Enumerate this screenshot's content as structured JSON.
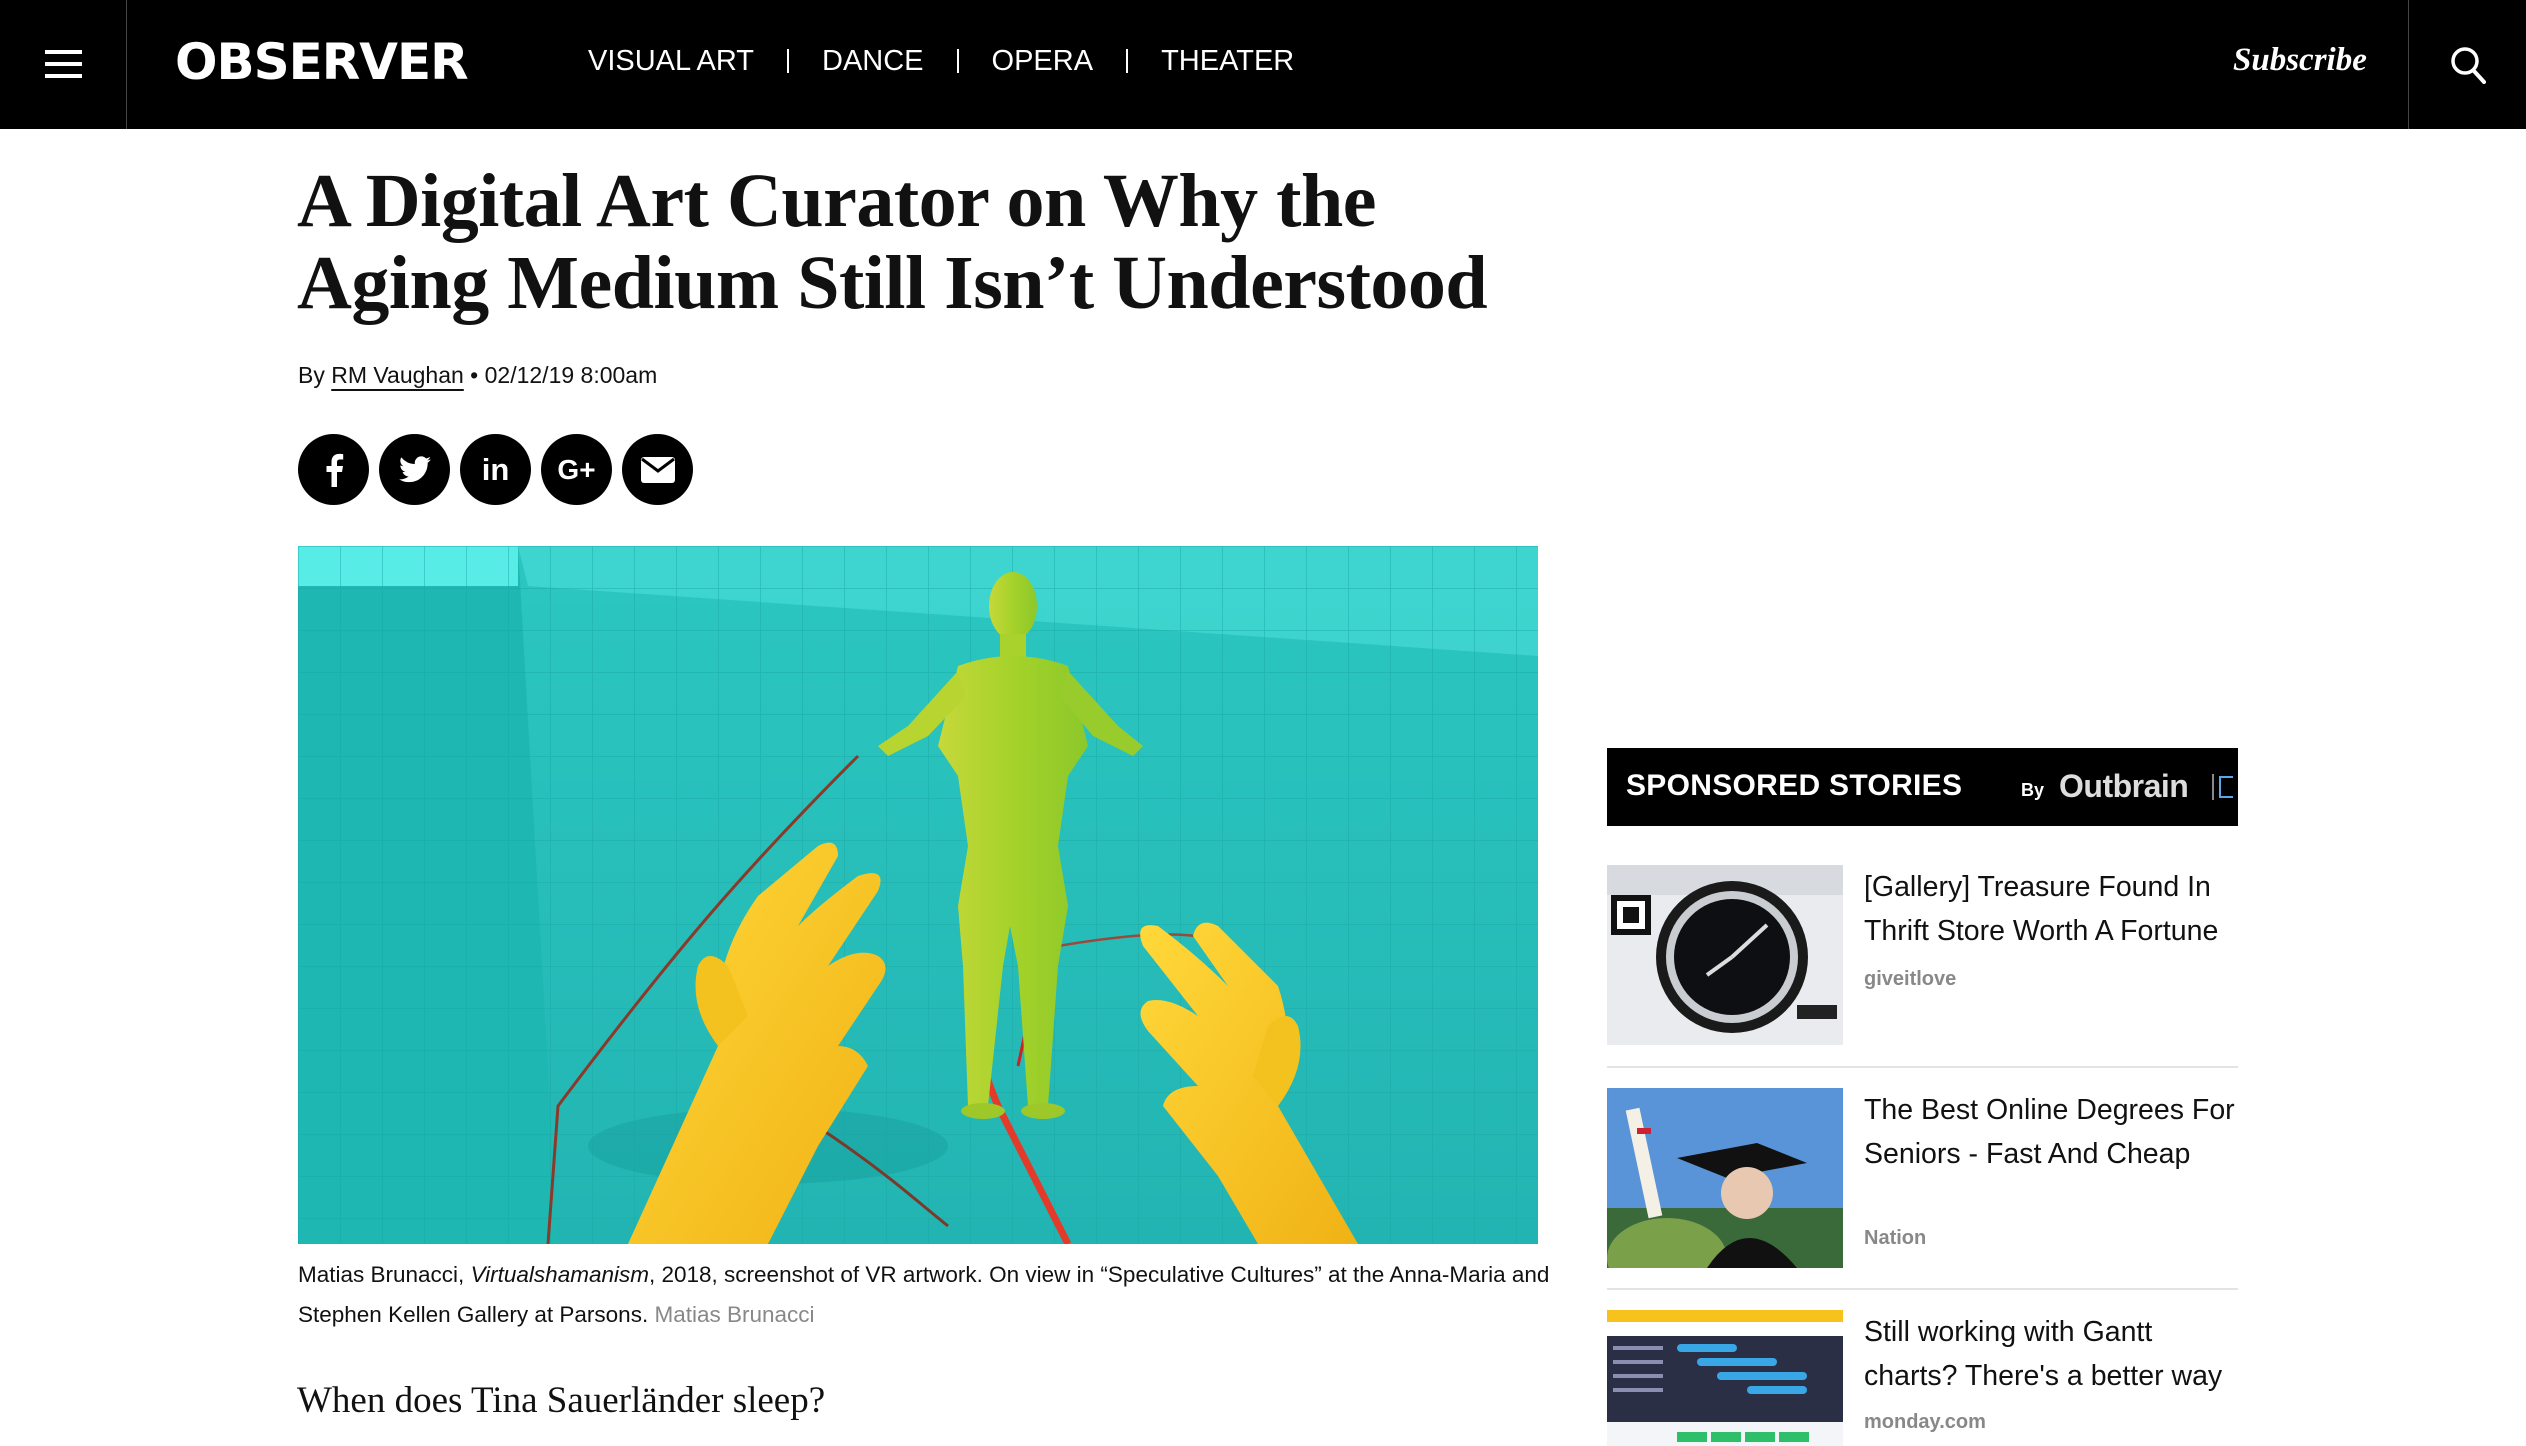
{
  "header": {
    "logo": "OBSERVER",
    "nav": [
      "VISUAL ART",
      "DANCE",
      "OPERA",
      "THEATER"
    ],
    "subscribe": "Subscribe"
  },
  "article": {
    "headline_line1": "A Digital Art Curator on Why the",
    "headline_line2": "Aging Medium Still Isn’t Understood",
    "by_prefix": "By",
    "author": "RM Vaughan",
    "date_sep": "•",
    "date": "02/12/19 8:00am",
    "caption_artist": "Matias Brunacci, ",
    "caption_title": "Virtualshamanism",
    "caption_rest": ", 2018, screenshot of VR artwork. On view in “Speculative Cultures” at the Anna-Maria and Stephen Kellen Gallery at Parsons.",
    "caption_credit": "Matias Brunacci",
    "lede": "When does Tina Sauerländer sleep?"
  },
  "share_buttons": [
    "facebook-icon",
    "twitter-icon",
    "linkedin-icon",
    "google-plus-icon",
    "email-icon"
  ],
  "share_labels": {
    "linkedin": "in",
    "google": "G+"
  },
  "sponsored": {
    "title": "SPONSORED STORIES",
    "by": "By",
    "brand": "Outbrain",
    "stories": [
      {
        "title": "[Gallery] Treasure Found In Thrift Store Worth A Fortune",
        "source": "giveitlove"
      },
      {
        "title": "The Best Online Degrees For Seniors - Fast And Cheap",
        "source": "Nation"
      },
      {
        "title": "Still working with Gantt charts? There's a better way",
        "source": "monday.com"
      }
    ]
  },
  "colors": {
    "topbar": "#000000",
    "hero_teal": "#2ec9c3",
    "figure_green": "#9fd12a",
    "hands_yellow": "#f2c81e"
  }
}
